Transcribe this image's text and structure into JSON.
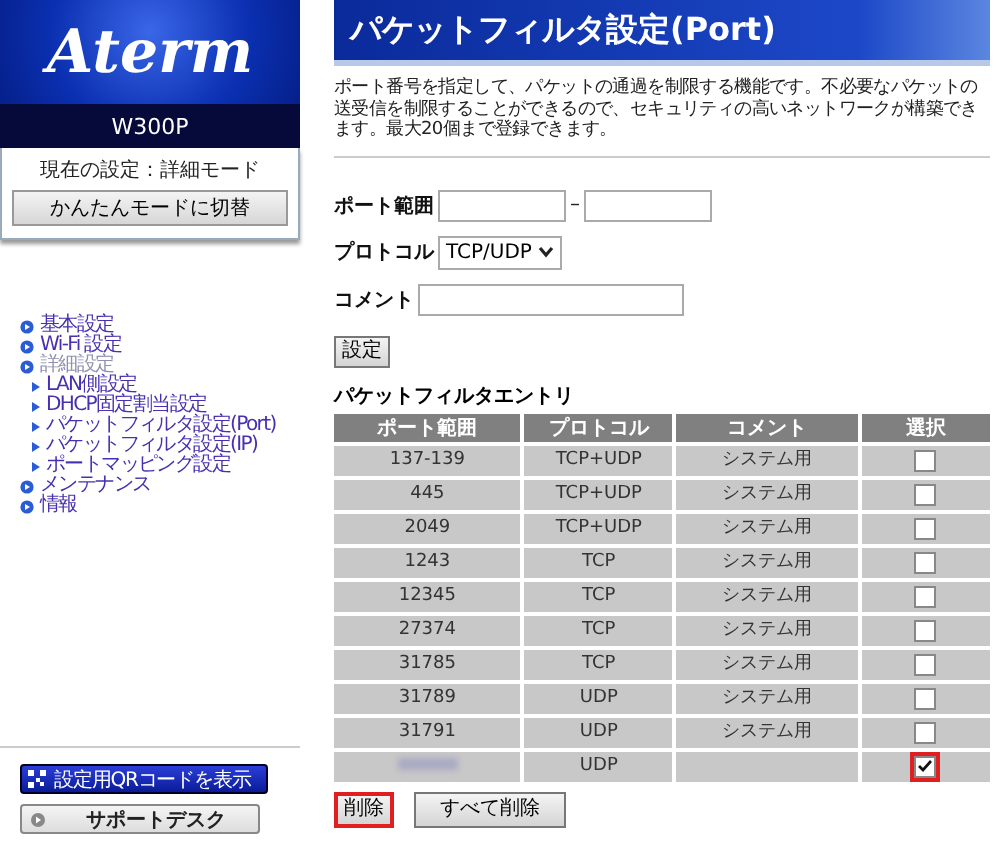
{
  "sidebar": {
    "logo": "Aterm",
    "model": "W300P",
    "mode_label": "現在の設定：詳細モード",
    "mode_button": "かんたんモードに切替",
    "nav": [
      {
        "label": "基本設定",
        "expanded": false
      },
      {
        "label": "Wi-Fi 設定",
        "expanded": false
      },
      {
        "label": "詳細設定",
        "expanded": true,
        "children": [
          {
            "label": "LAN側設定"
          },
          {
            "label": "DHCP固定割当設定"
          },
          {
            "label": "パケットフィルタ設定(Port)"
          },
          {
            "label": "パケットフィルタ設定(IP)"
          },
          {
            "label": "ポートマッピング設定"
          }
        ]
      },
      {
        "label": "メンテナンス",
        "expanded": false
      },
      {
        "label": "情報",
        "expanded": false
      }
    ],
    "qr_button": "設定用QRコードを表示",
    "support_button": "サポートデスク"
  },
  "title": "パケットフィルタ設定(Port)",
  "description": "ポート番号を指定して、パケットの通過を制限する機能です。不必要なパケットの送受信を制限することができるので、セキュリティの高いネットワークが構築できます。最大20個まで登録できます。",
  "form": {
    "port_label": "ポート範囲",
    "dash": "–",
    "protocol_label": "プロトコル",
    "protocol_value": "TCP/UDP",
    "comment_label": "コメント",
    "submit": "設定"
  },
  "table": {
    "title": "パケットフィルタエントリ",
    "columns": [
      "ポート範囲",
      "プロトコル",
      "コメント",
      "選択"
    ],
    "rows": [
      {
        "port": "137-139",
        "protocol": "TCP+UDP",
        "comment": "システム用",
        "checked": false,
        "highlighted": false
      },
      {
        "port": "445",
        "protocol": "TCP+UDP",
        "comment": "システム用",
        "checked": false,
        "highlighted": false
      },
      {
        "port": "2049",
        "protocol": "TCP+UDP",
        "comment": "システム用",
        "checked": false,
        "highlighted": false
      },
      {
        "port": "1243",
        "protocol": "TCP",
        "comment": "システム用",
        "checked": false,
        "highlighted": false
      },
      {
        "port": "12345",
        "protocol": "TCP",
        "comment": "システム用",
        "checked": false,
        "highlighted": false
      },
      {
        "port": "27374",
        "protocol": "TCP",
        "comment": "システム用",
        "checked": false,
        "highlighted": false
      },
      {
        "port": "31785",
        "protocol": "TCP",
        "comment": "システム用",
        "checked": false,
        "highlighted": false
      },
      {
        "port": "31789",
        "protocol": "UDP",
        "comment": "システム用",
        "checked": false,
        "highlighted": false
      },
      {
        "port": "31791",
        "protocol": "UDP",
        "comment": "システム用",
        "checked": false,
        "highlighted": false
      },
      {
        "protocol": "UDP",
        "checked": true,
        "highlighted": true
      }
    ]
  },
  "buttons": [
    {
      "label": "削除",
      "highlighted": true
    },
    {
      "label": "すべて削除",
      "highlighted": false
    }
  ]
}
